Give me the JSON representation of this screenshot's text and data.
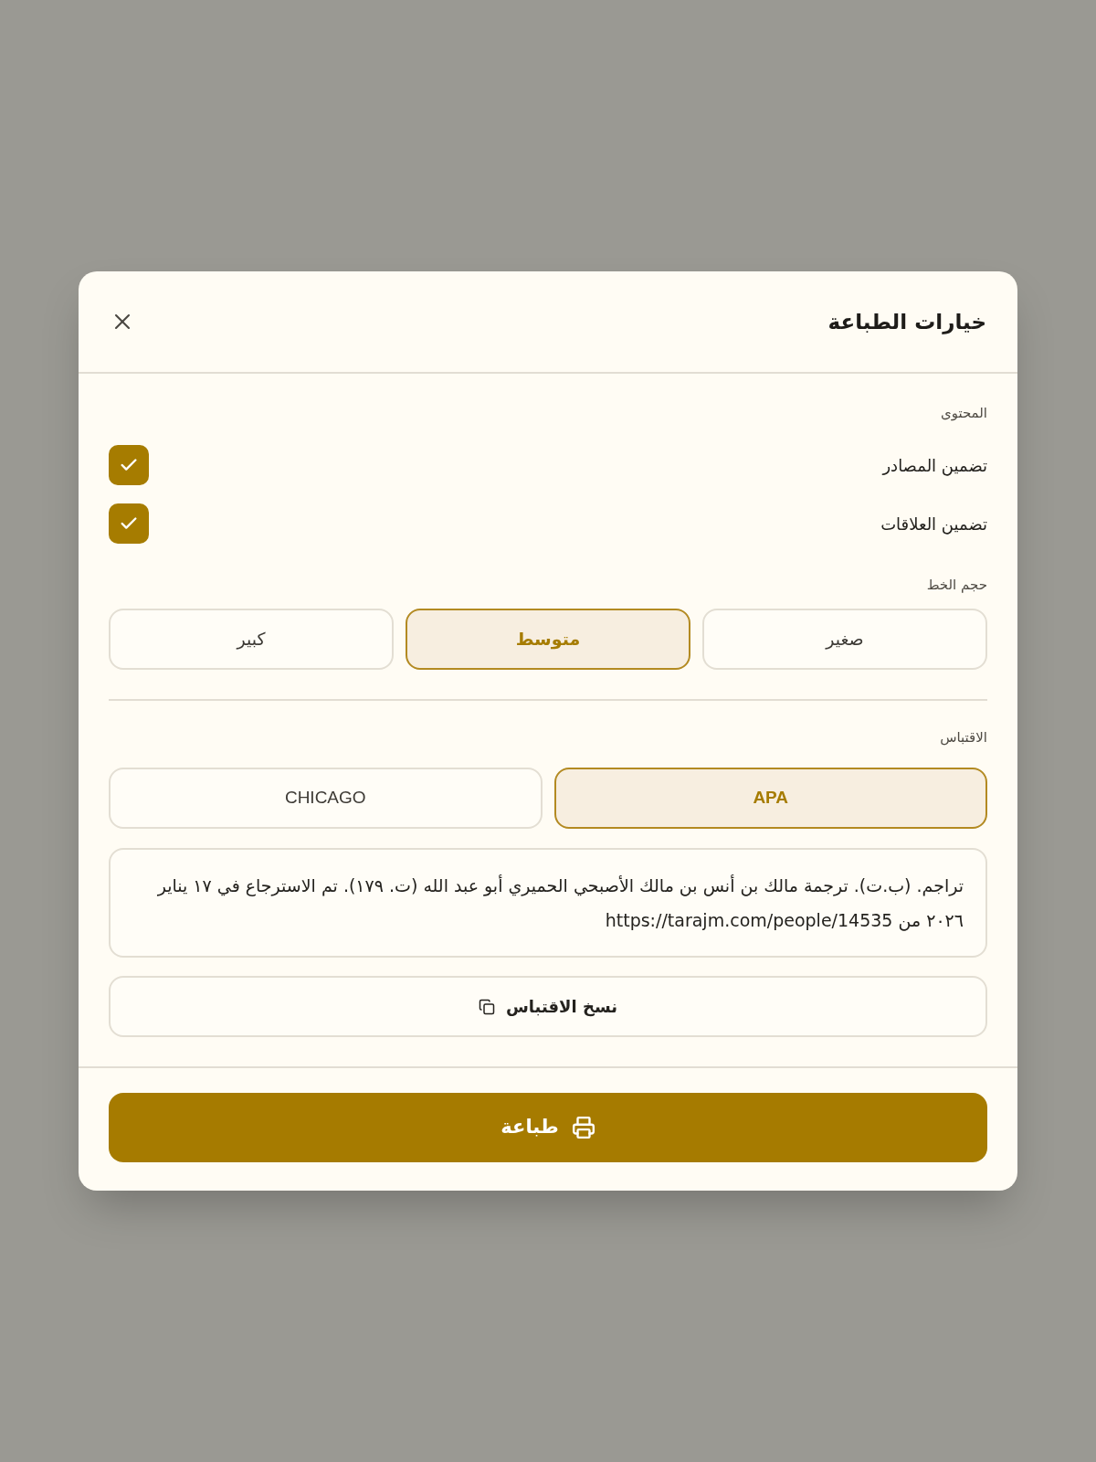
{
  "dialog": {
    "title": "خيارات الطباعة"
  },
  "content": {
    "label": "المحتوى",
    "options": [
      {
        "label": "تضمين المصادر",
        "checked": true
      },
      {
        "label": "تضمين العلاقات",
        "checked": true
      }
    ]
  },
  "font_size": {
    "label": "حجم الخط",
    "options": [
      {
        "label": "صغير",
        "selected": false
      },
      {
        "label": "متوسط",
        "selected": true
      },
      {
        "label": "كبير",
        "selected": false
      }
    ]
  },
  "citation": {
    "label": "الاقتباس",
    "styles": [
      {
        "label": "APA",
        "selected": true
      },
      {
        "label": "CHICAGO",
        "selected": false
      }
    ],
    "text": "تراجم. (ب.ت). ترجمة مالك بن أنس بن مالك الأصبحي الحميري أبو عبد الله (ت. ١٧٩). تم الاسترجاع في ١٧ يناير ٢٠٢٦ من https://tarajm.com/people/14535",
    "copy_button": "نسخ الاقتباس"
  },
  "print_button": "طباعة"
}
